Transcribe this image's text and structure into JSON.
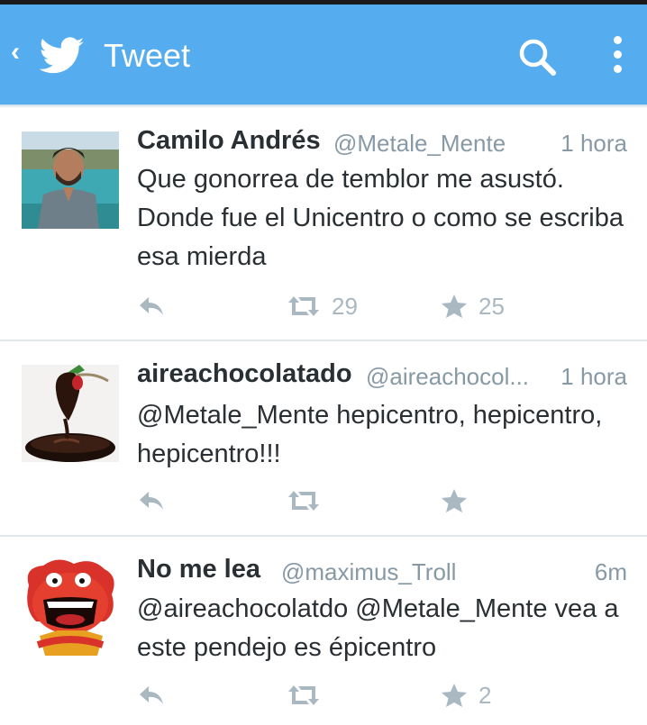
{
  "header": {
    "back_icon": "chevron-left-icon",
    "logo_icon": "twitter-bird-icon",
    "title": "Tweet",
    "search_icon": "search-icon",
    "menu_icon": "overflow-menu-icon",
    "color": "#55acee"
  },
  "tweets": [
    {
      "name": "Camilo Andrés",
      "handle": "@Metale_Mente",
      "time": "1 hora",
      "text": "Que gonorrea de temblor me asustó. Donde fue el Unicentro o como se escriba esa mierda",
      "retweets": "29",
      "favorites": "25"
    },
    {
      "name": "aireachocolatado",
      "handle": "@aireachocol...",
      "time": "1 hora",
      "text": "@Metale_Mente hepicentro, hepicentro, hepicentro!!!",
      "retweets": "",
      "favorites": ""
    },
    {
      "name": "No me lea",
      "handle": "@maximus_Troll",
      "time": "6m",
      "text": "@aireachocolatdo @Metale_Mente vea a este pendejo es épicentro",
      "retweets": "",
      "favorites": "2"
    }
  ]
}
